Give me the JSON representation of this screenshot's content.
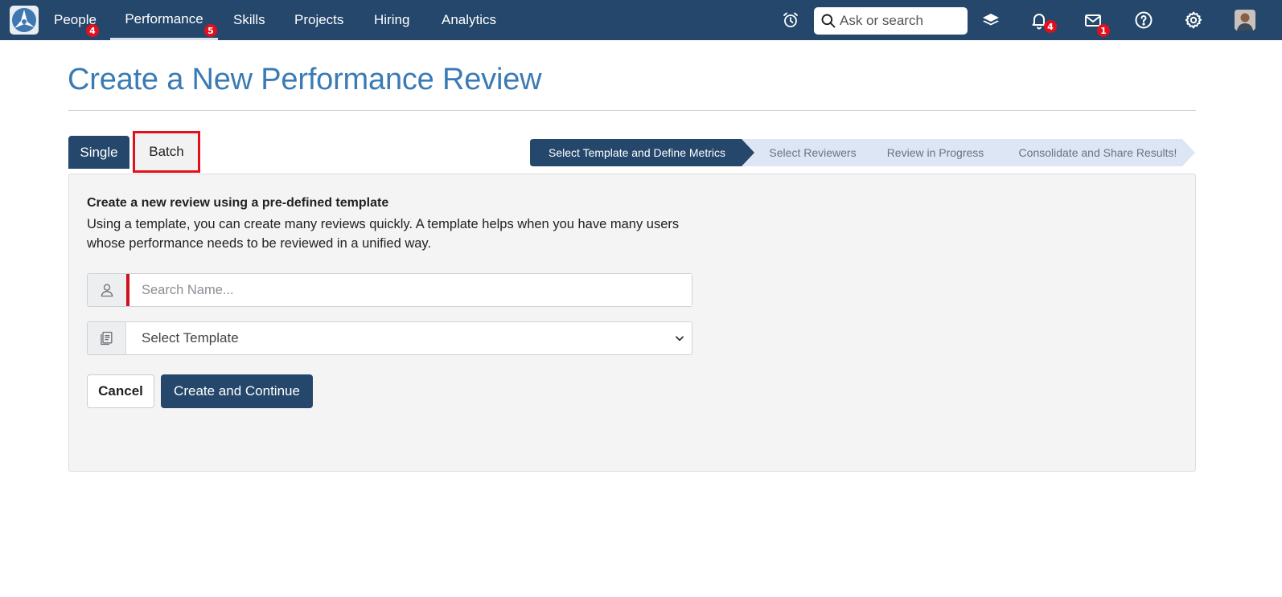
{
  "nav": {
    "items": [
      {
        "label": "People",
        "badge": "4"
      },
      {
        "label": "Performance",
        "badge": "5"
      },
      {
        "label": "Skills"
      },
      {
        "label": "Projects"
      },
      {
        "label": "Hiring"
      },
      {
        "label": "Analytics"
      }
    ],
    "active": "Performance",
    "search_placeholder": "Ask or search",
    "notifications_badge": "4",
    "messages_badge": "1",
    "icons": [
      "logo",
      "alarm-clock-icon",
      "search-icon",
      "layers-icon",
      "bell-icon",
      "mail-icon",
      "help-icon",
      "gear-icon",
      "avatar"
    ]
  },
  "page": {
    "title": "Create a New Performance Review"
  },
  "tabs": {
    "single": "Single",
    "batch": "Batch",
    "selected": "Single",
    "highlighted": "Batch"
  },
  "steps": [
    {
      "label": "Select Template and Define Metrics",
      "current": true
    },
    {
      "label": "Select Reviewers",
      "current": false
    },
    {
      "label": "Review in Progress",
      "current": false
    },
    {
      "label": "Consolidate and Share Results!",
      "current": false
    }
  ],
  "form": {
    "heading": "Create a new review using a pre-defined template",
    "description": "Using a template, you can create many reviews quickly. A template helps when you have many users whose performance needs to be reviewed in a unified way.",
    "name_placeholder": "Search Name...",
    "template_selected": "Select Template",
    "cancel_label": "Cancel",
    "create_label": "Create and Continue"
  },
  "colors": {
    "navbar": "#24476b",
    "title": "#3b7bb5",
    "badge": "#e0101f",
    "highlight": "#e3101b",
    "step_current": "#24476b",
    "step_other": "#dde6f4"
  }
}
